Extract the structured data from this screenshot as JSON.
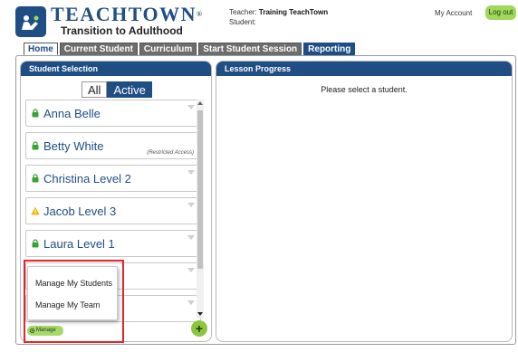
{
  "brand": {
    "name": "TEACHTOWN",
    "trademark": "®",
    "tagline": "Transition to Adulthood"
  },
  "header": {
    "teacher_label": "Teacher:",
    "teacher_name": "Training TeachTown",
    "student_label": "Student:",
    "my_account": "My Account",
    "logout": "Log out"
  },
  "tabs": [
    {
      "label": "Home",
      "active": true
    },
    {
      "label": "Current Student"
    },
    {
      "label": "Curriculum"
    },
    {
      "label": "Start Student Session"
    },
    {
      "label": "Reporting"
    }
  ],
  "student_panel": {
    "title": "Student Selection",
    "filter_all": "All",
    "filter_active": "Active",
    "students": [
      {
        "name": "Anna Belle",
        "icon": "lock-icon"
      },
      {
        "name": "Betty White",
        "icon": "lock-icon",
        "note": "(Restricted Access)"
      },
      {
        "name": "Christina Level 2",
        "icon": "lock-icon"
      },
      {
        "name": "Jacob Level 3",
        "icon": "warning-icon"
      },
      {
        "name": "Laura Level 1",
        "icon": "lock-icon"
      }
    ],
    "manage_label": "Manage",
    "add_label": "+",
    "manage_menu": [
      "Manage My Students",
      "Manage My Team"
    ]
  },
  "progress_panel": {
    "title": "Lesson Progress",
    "message": "Please select a student."
  },
  "colors": {
    "brand_blue": "#1f4e85",
    "accent_green": "#8cc63f",
    "lock_green": "#3aa335",
    "warning_yellow": "#f2b600",
    "highlight_red": "#e5242b"
  }
}
